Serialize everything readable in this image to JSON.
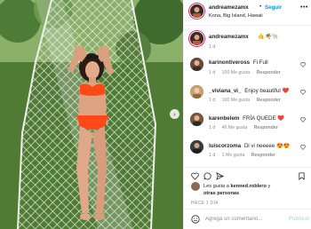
{
  "post": {
    "username": "andreamezamx",
    "dot": "•",
    "follow_label": "Seguir",
    "location": "Kona, Big Island, Hawaii",
    "more_icon": "ellipsis-icon"
  },
  "caption": {
    "username": "andreamezamx",
    "emojis": "🤙🌴🐚",
    "time": "1 d"
  },
  "comments": [
    {
      "username": "karinontiveross",
      "text": "Fi Full",
      "time": "1 d",
      "likes": "100 Me gusta",
      "reply": "Responder"
    },
    {
      "username": "_viviana_vi_",
      "text": "Enjoy beautiful",
      "emoji": "❤️",
      "time": "1 d",
      "likes": "100 Me gusta",
      "reply": "Responder"
    },
    {
      "username": "karenbelem",
      "text": "FRÍA QUEDE",
      "emoji": "❤️",
      "time": "1 d",
      "likes": "46 Me gusta",
      "reply": "Responder"
    },
    {
      "username": "luiscorzoma",
      "text": "Di vi neeeee",
      "emoji": "😍😍",
      "time": "1 d",
      "likes": "1 Me gusta",
      "reply": "Responder"
    }
  ],
  "likes_summary": {
    "prefix": "Les gusta a ",
    "user": "kenned.roblero",
    "connector": " y",
    "others": "otras personas"
  },
  "date": "HACE 1 DÍA",
  "add_comment": {
    "placeholder": "Agrega un comentario...",
    "publish_label": "Publicar"
  },
  "colors": {
    "link_blue": "#0095f6",
    "muted": "#8e8e8e",
    "text": "#262626",
    "bikini": "#ff4a17"
  }
}
